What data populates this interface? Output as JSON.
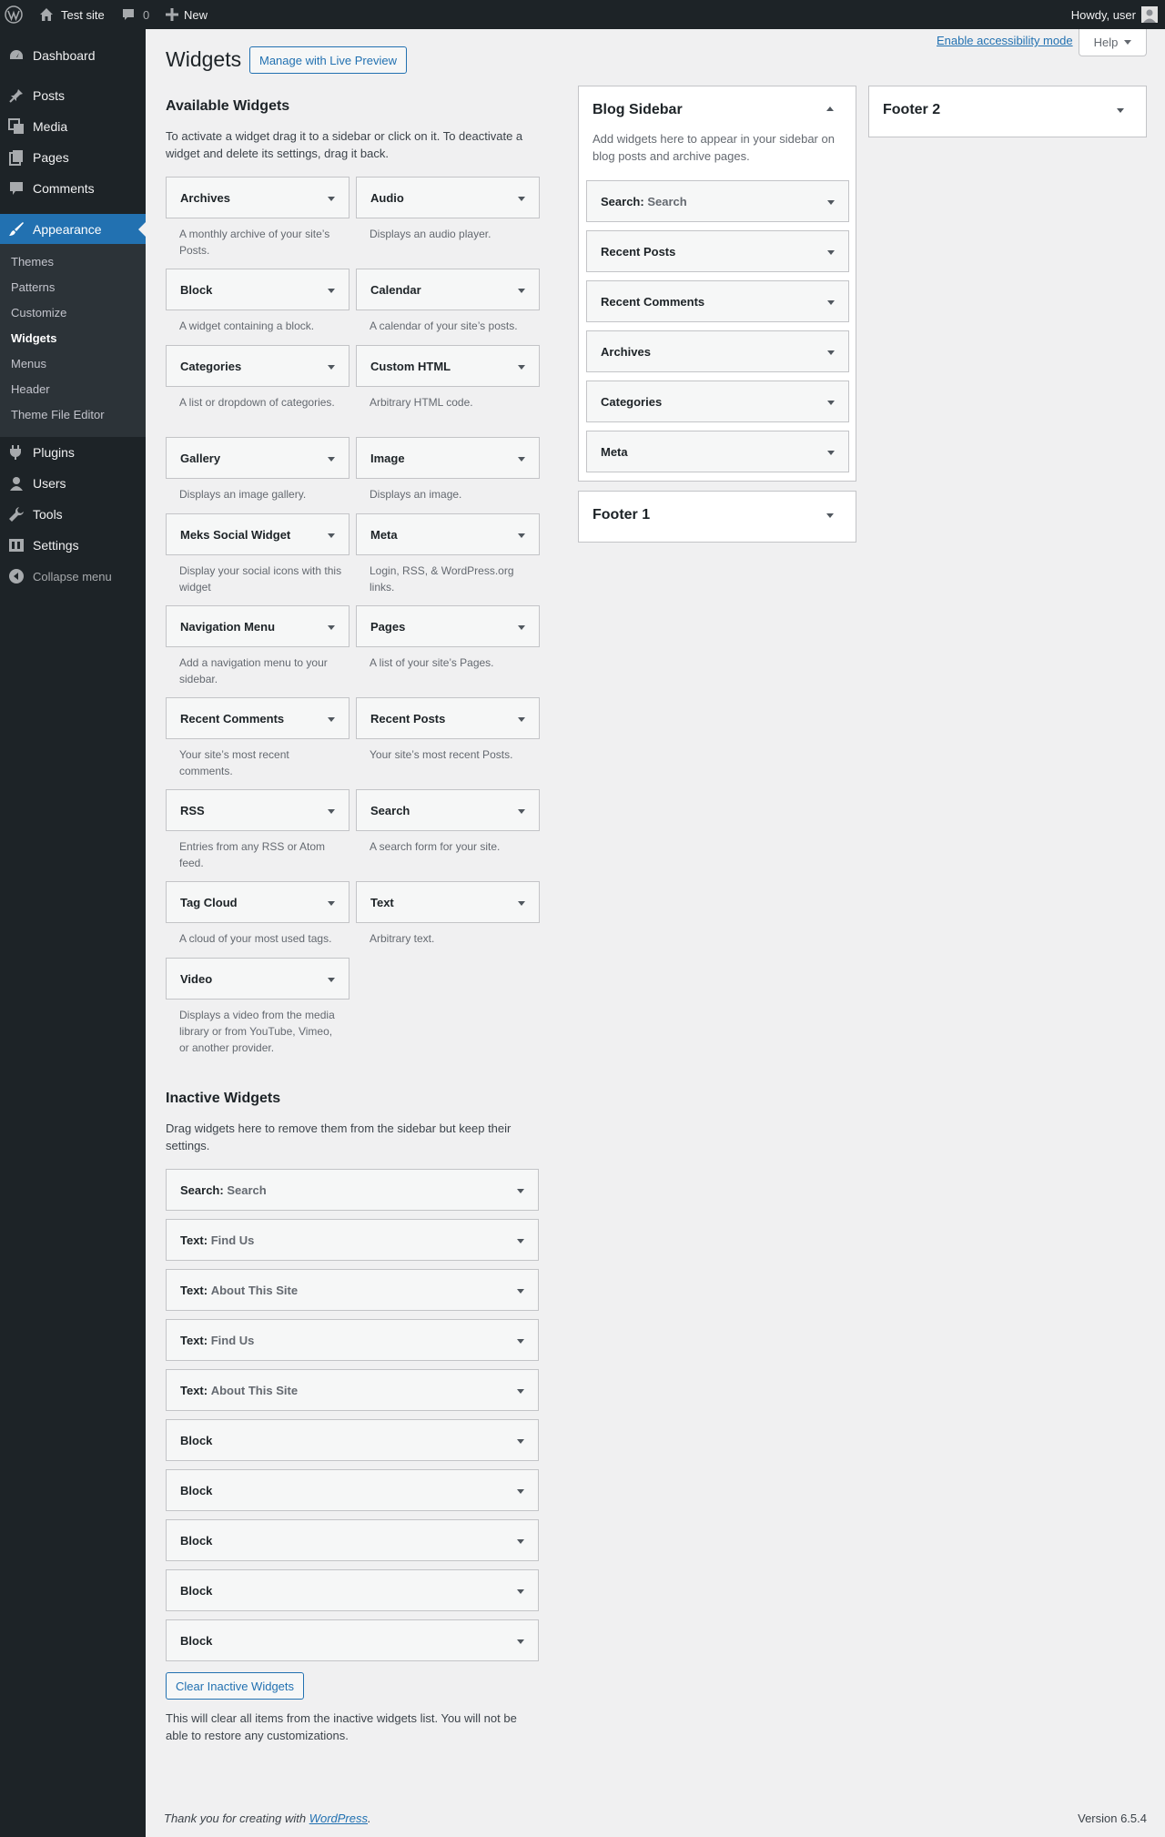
{
  "admin_bar": {
    "site_name": "Test site",
    "comments_count": "0",
    "new_label": "New",
    "howdy": "Howdy, user"
  },
  "sidebar": {
    "items": [
      {
        "label": "Dashboard",
        "icon": "dashboard-icon"
      },
      {
        "label": "Posts",
        "icon": "pin-icon"
      },
      {
        "label": "Media",
        "icon": "media-icon"
      },
      {
        "label": "Pages",
        "icon": "pages-icon"
      },
      {
        "label": "Comments",
        "icon": "comment-icon"
      },
      {
        "label": "Appearance",
        "icon": "brush-icon"
      },
      {
        "label": "Plugins",
        "icon": "plug-icon"
      },
      {
        "label": "Users",
        "icon": "user-icon"
      },
      {
        "label": "Tools",
        "icon": "wrench-icon"
      },
      {
        "label": "Settings",
        "icon": "settings-icon"
      }
    ],
    "submenu": [
      "Themes",
      "Patterns",
      "Customize",
      "Widgets",
      "Menus",
      "Header",
      "Theme File Editor"
    ],
    "collapse_label": "Collapse menu"
  },
  "header": {
    "title": "Widgets",
    "live_preview_label": "Manage with Live Preview",
    "accessibility_link": "Enable accessibility mode",
    "help_label": "Help"
  },
  "available": {
    "title": "Available Widgets",
    "description": "To activate a widget drag it to a sidebar or click on it. To deactivate a widget and delete its settings, drag it back.",
    "widgets": [
      {
        "name": "Archives",
        "desc": "A monthly archive of your site’s Posts."
      },
      {
        "name": "Audio",
        "desc": "Displays an audio player."
      },
      {
        "name": "Block",
        "desc": "A widget containing a block."
      },
      {
        "name": "Calendar",
        "desc": "A calendar of your site’s posts."
      },
      {
        "name": "Categories",
        "desc": "A list or dropdown of categories."
      },
      {
        "name": "Custom HTML",
        "desc": "Arbitrary HTML code."
      },
      {
        "name": "Gallery",
        "desc": "Displays an image gallery."
      },
      {
        "name": "Image",
        "desc": "Displays an image."
      },
      {
        "name": "Meks Social Widget",
        "desc": "Display your social icons with this widget"
      },
      {
        "name": "Meta",
        "desc": "Login, RSS, & WordPress.org links."
      },
      {
        "name": "Navigation Menu",
        "desc": "Add a navigation menu to your sidebar."
      },
      {
        "name": "Pages",
        "desc": "A list of your site’s Pages."
      },
      {
        "name": "Recent Comments",
        "desc": "Your site’s most recent comments."
      },
      {
        "name": "Recent Posts",
        "desc": "Your site’s most recent Posts."
      },
      {
        "name": "RSS",
        "desc": "Entries from any RSS or Atom feed."
      },
      {
        "name": "Search",
        "desc": "A search form for your site."
      },
      {
        "name": "Tag Cloud",
        "desc": "A cloud of your most used tags."
      },
      {
        "name": "Text",
        "desc": "Arbitrary text."
      },
      {
        "name": "Video",
        "desc": "Displays a video from the media library or from YouTube, Vimeo, or another provider."
      }
    ]
  },
  "inactive": {
    "title": "Inactive Widgets",
    "description": "Drag widgets here to remove them from the sidebar but keep their settings.",
    "widgets": [
      {
        "name": "Search",
        "sub": "Search"
      },
      {
        "name": "Text",
        "sub": "Find Us"
      },
      {
        "name": "Text",
        "sub": "About This Site"
      },
      {
        "name": "Text",
        "sub": "Find Us"
      },
      {
        "name": "Text",
        "sub": "About This Site"
      },
      {
        "name": "Block",
        "sub": ""
      },
      {
        "name": "Block",
        "sub": ""
      },
      {
        "name": "Block",
        "sub": ""
      },
      {
        "name": "Block",
        "sub": ""
      },
      {
        "name": "Block",
        "sub": ""
      }
    ],
    "clear_label": "Clear Inactive Widgets",
    "clear_note": "This will clear all items from the inactive widgets list. You will not be able to restore any customizations."
  },
  "blog_sidebar": {
    "title": "Blog Sidebar",
    "description": "Add widgets here to appear in your sidebar on blog posts and archive pages.",
    "widgets": [
      {
        "name": "Search",
        "sub": "Search"
      },
      {
        "name": "Recent Posts",
        "sub": ""
      },
      {
        "name": "Recent Comments",
        "sub": ""
      },
      {
        "name": "Archives",
        "sub": ""
      },
      {
        "name": "Categories",
        "sub": ""
      },
      {
        "name": "Meta",
        "sub": ""
      }
    ]
  },
  "footer1": {
    "title": "Footer 1"
  },
  "footer2": {
    "title": "Footer 2"
  },
  "footer": {
    "thanks_prefix": "Thank you for creating with ",
    "thanks_link": "WordPress",
    "thanks_suffix": ".",
    "version": "Version 6.5.4"
  },
  "colors": {
    "accent": "#2271b1",
    "menu_bg": "#1d2327",
    "submenu_bg": "#2c3338",
    "page_bg": "#f0f0f1"
  }
}
